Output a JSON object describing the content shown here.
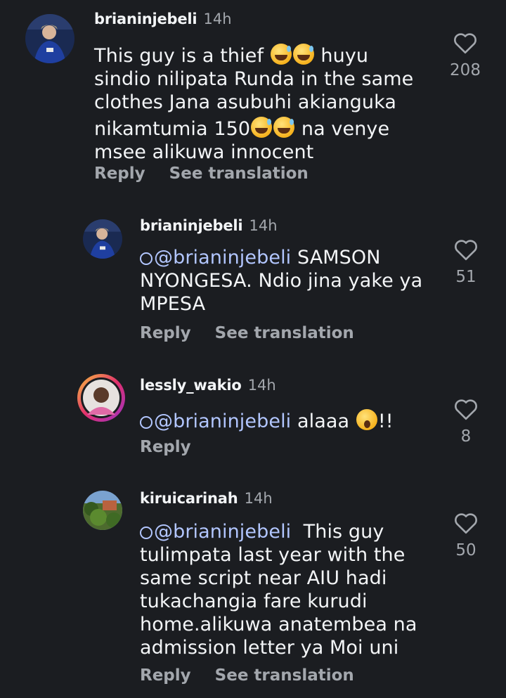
{
  "colors": {
    "background": "#1b1d21",
    "text": "#f3f5f7",
    "secondary": "#a3a7ad",
    "mention": "#b2c6ff"
  },
  "comments": [
    {
      "username": "brianinjebeli",
      "time": "14h",
      "text_lines": [
        "This guy is a thief 😅😅 huyu",
        "sindio nilipata Runda in the same",
        "clothes Jana asubuhi akianguka",
        "nikamtumia 150😅😅 na venye",
        "msee alikuwa innocent"
      ],
      "likes": "208",
      "reply_label": "Reply",
      "translate_label": "See translation"
    },
    {
      "username": "brianinjebeli",
      "time": "14h",
      "mention": "@brianinjebeli",
      "text_lines": [
        " SAMSON",
        "NYONGESA. Ndio jina yake ya",
        "MPESA"
      ],
      "likes": "51",
      "reply_label": "Reply",
      "translate_label": "See translation"
    },
    {
      "username": "lessly_wakio",
      "time": "14h",
      "mention": "@brianinjebeli",
      "text_lines": [
        " alaaa 😮!!"
      ],
      "likes": "8",
      "reply_label": "Reply"
    },
    {
      "username": "kiruicarinah",
      "time": "14h",
      "mention": "@brianinjebeli",
      "text_lines": [
        "  This guy",
        "tulimpata last year with the",
        "same script near AIU hadi",
        "tukachangia fare kurudi",
        "home.alikuwa anatembea na",
        "admission letter ya Moi uni"
      ],
      "likes": "50",
      "reply_label": "Reply",
      "translate_label": "See translation"
    }
  ]
}
